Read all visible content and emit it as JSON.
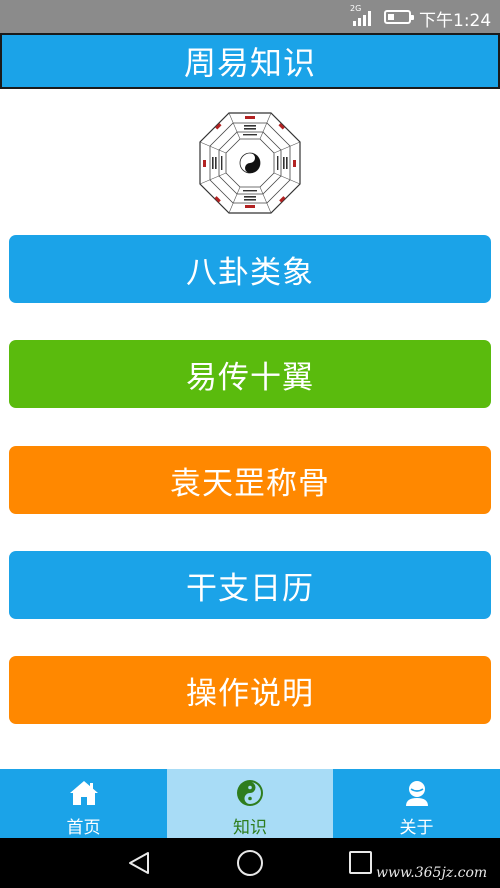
{
  "status_bar": {
    "network": "2G",
    "time": "下午1:24"
  },
  "header": {
    "title": "周易知识"
  },
  "menu": [
    {
      "label": "八卦类象",
      "color": "#1ba3e8"
    },
    {
      "label": "易传十翼",
      "color": "#5abb0d"
    },
    {
      "label": "袁天罡称骨",
      "color": "#ff8800"
    },
    {
      "label": "干支日历",
      "color": "#1ba3e8"
    },
    {
      "label": "操作说明",
      "color": "#ff8800"
    }
  ],
  "bottom_nav": [
    {
      "label": "首页",
      "icon": "home-icon"
    },
    {
      "label": "知识",
      "icon": "yin-yang-icon",
      "selected": true
    },
    {
      "label": "关于",
      "icon": "user-icon"
    }
  ],
  "watermark": "www.365jz.com"
}
